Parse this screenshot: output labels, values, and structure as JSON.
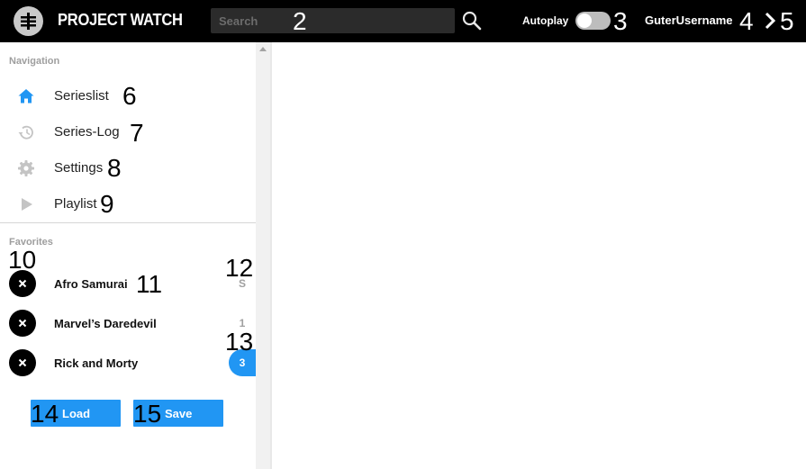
{
  "app": {
    "title": "PROJECT WATCH"
  },
  "header": {
    "search_placeholder": "Search",
    "autoplay_label": "Autoplay",
    "autoplay_on": false,
    "username": "GuterUsername"
  },
  "sidebar": {
    "navigation_title": "Navigation",
    "nav_items": [
      {
        "label": "Serieslist",
        "icon": "home-icon",
        "active": true
      },
      {
        "label": "Series-Log",
        "icon": "history-icon"
      },
      {
        "label": "Settings",
        "icon": "gear-icon"
      },
      {
        "label": "Playlist",
        "icon": "play-icon"
      }
    ],
    "favorites_title": "Favorites",
    "favorites": [
      {
        "name": "Afro Samurai",
        "badge": "S"
      },
      {
        "name": "Marvel’s Daredevil",
        "badge": "1"
      },
      {
        "name": "Rick and Morty",
        "badge": "3",
        "badge_active": true
      }
    ]
  },
  "buttons": {
    "load": "Load",
    "save": "Save"
  },
  "markers": [
    "2",
    "3",
    "4",
    "5",
    "6",
    "7",
    "8",
    "9",
    "10",
    "11",
    "12",
    "13",
    "14",
    "15"
  ],
  "colors": {
    "accent": "#2196f3",
    "topbar": "#000000",
    "nav_active": "#2196f3",
    "nav_inactive": "#c4c4c4"
  }
}
